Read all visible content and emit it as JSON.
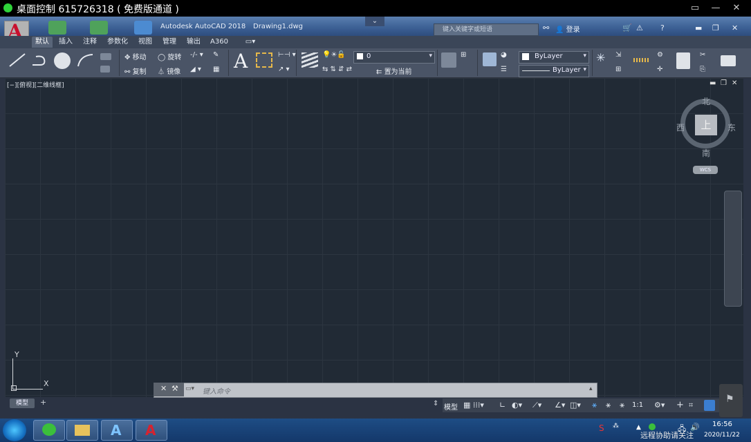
{
  "remote": {
    "title": "桌面控制 615726318 ( 免费版通道 )",
    "buttons": [
      "▭",
      "—",
      "□",
      "✕"
    ]
  },
  "acad": {
    "app_name": "Autodesk AutoCAD 2018",
    "document": "Drawing1.dwg",
    "search_placeholder": "键入关键字或短语",
    "login_label": "登录"
  },
  "tabs": [
    "默认",
    "插入",
    "注释",
    "参数化",
    "视图",
    "管理",
    "输出",
    "A360"
  ],
  "ribbon": {
    "move": "移动",
    "rotate": "旋转",
    "copy": "复制",
    "mirror": "镜像",
    "layer_value": "0",
    "set_current": "置为当前",
    "bylayer_color": "ByLayer",
    "bylayer_linetype": "ByLayer"
  },
  "viewport": {
    "label": "[−][俯视][二维线框]",
    "compass_n": "北",
    "compass_s": "南",
    "compass_e": "东",
    "compass_w": "西",
    "cube_face": "上",
    "wcs": "WCS",
    "ucs_x": "X",
    "ucs_y": "Y"
  },
  "command": {
    "placeholder": "键入命令"
  },
  "layout_tabs": {
    "model": "模型",
    "add": "+"
  },
  "status": {
    "model": "模型",
    "scale": "1:1"
  },
  "taskbar": {
    "time": "16:56",
    "date": "2020/11/22",
    "watermark": "远程协助请关注"
  },
  "colors": {
    "canvas": "#212a35",
    "title_bar": "#3b5f93",
    "ribbon": "#4a5466",
    "taskbar": "#14386a"
  }
}
